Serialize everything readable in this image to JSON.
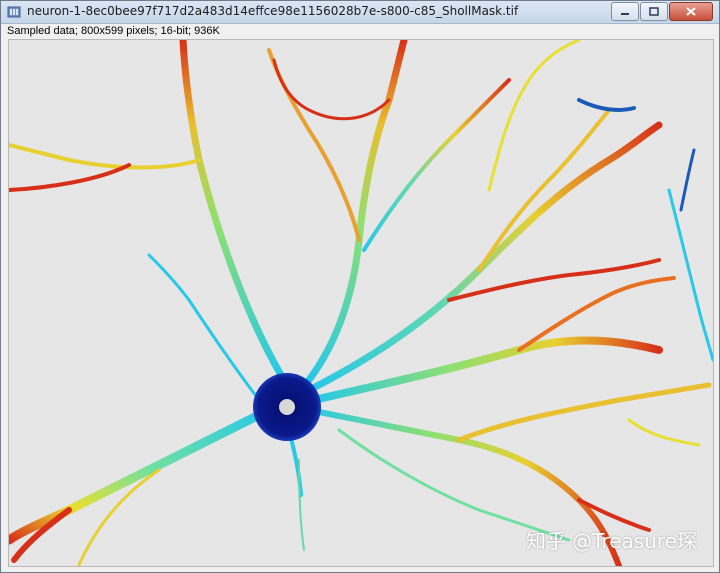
{
  "window": {
    "title": "neuron-1-8ec0bee97f717d2a483d14effce98e1156028b7e-s800-c85_ShollMask.tif",
    "info": "Sampled data; 800x599 pixels; 16-bit; 936K",
    "icons": [
      "image-window-icon",
      "minimize-icon",
      "maximize-icon",
      "close-icon"
    ]
  },
  "image": {
    "description_kind": "sholl-mask-neuron",
    "colors": {
      "soma": "#0a1a8c",
      "soma_center": "#d8d8d8",
      "background": "#e6e6e6",
      "near": "#28c8e8",
      "mid": "#e8e030",
      "far": "#d83018",
      "edge_blue": "#1a5ab8"
    }
  },
  "watermark": {
    "text": "知乎 @Treasure琛"
  }
}
